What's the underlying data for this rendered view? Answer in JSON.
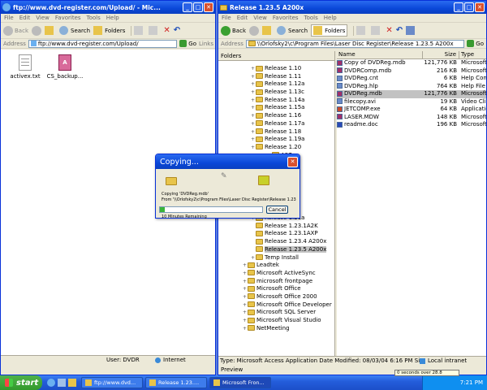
{
  "ie": {
    "title": "ftp://www.dvd-register.com/Upload/ - Mic...",
    "menu": [
      "File",
      "Edit",
      "View",
      "Favorites",
      "Tools",
      "Help"
    ],
    "back_label": "Back",
    "search_label": "Search",
    "folders_label": "Folders",
    "address_label": "Address",
    "address_value": "ftp://www.dvd-register.com/Upload/",
    "go_label": "Go",
    "links_label": "Links",
    "files": [
      "activex.txt",
      "CS_backup..."
    ],
    "status_user": "User: DVDR",
    "status_zone": "Internet"
  },
  "explorer": {
    "title": "Release 1.23.5 A200x",
    "menu": [
      "File",
      "Edit",
      "View",
      "Favorites",
      "Tools",
      "Help"
    ],
    "back_label": "Back",
    "search_label": "Search",
    "folders_label": "Folders",
    "address_label": "Address",
    "address_value": "\\\\Orlofsky2\\c\\Program Files\\Laser Disc Register\\Release 1.23.5 A200x",
    "go_label": "Go",
    "folders_header": "Folders",
    "tree": [
      {
        "label": "Release 1.10",
        "indent": 1,
        "exp": "+"
      },
      {
        "label": "Release 1.11",
        "indent": 1,
        "exp": "+"
      },
      {
        "label": "Release 1.12a",
        "indent": 1,
        "exp": "+"
      },
      {
        "label": "Release 1.13c",
        "indent": 1,
        "exp": "+"
      },
      {
        "label": "Release 1.14a",
        "indent": 1,
        "exp": "+"
      },
      {
        "label": "Release 1.15a",
        "indent": 1,
        "exp": "+"
      },
      {
        "label": "Release 1.16",
        "indent": 1,
        "exp": "+"
      },
      {
        "label": "Release 1.17a",
        "indent": 1,
        "exp": "+"
      },
      {
        "label": "Release 1.18",
        "indent": 1,
        "exp": "+"
      },
      {
        "label": "Release 1.19a",
        "indent": 1,
        "exp": "+"
      },
      {
        "label": "Release 1.20",
        "indent": 1,
        "exp": "+"
      },
      {
        "label": "A97",
        "indent": 3,
        "exp": ""
      },
      {
        "label": "3",
        "indent": 3,
        "exp": ""
      },
      {
        "label": ".5 A97",
        "indent": 3,
        "exp": ""
      },
      {
        "label": ".5A2K",
        "indent": 3,
        "exp": ""
      },
      {
        "label": ".5XP",
        "indent": 3,
        "exp": ""
      },
      {
        "label": ".4XP",
        "indent": 3,
        "exp": ""
      },
      {
        "label": ".7A2K",
        "indent": 3,
        "exp": ""
      },
      {
        "label": ".7AXP",
        "indent": 3,
        "exp": ""
      },
      {
        "label": "Release 1.21a",
        "indent": 1,
        "exp": "+"
      },
      {
        "label": "Release 1.23.1A2K",
        "indent": 1,
        "exp": ""
      },
      {
        "label": "Release 1.23.1AXP",
        "indent": 1,
        "exp": ""
      },
      {
        "label": "Release 1.23.4 A200x",
        "indent": 1,
        "exp": ""
      },
      {
        "label": "Release 1.23.5 A200x",
        "indent": 1,
        "exp": "",
        "sel": true
      },
      {
        "label": "Temp Install",
        "indent": 1,
        "exp": "+"
      },
      {
        "label": "Leadtek",
        "indent": 0,
        "exp": "+"
      },
      {
        "label": "Microsoft ActiveSync",
        "indent": 0,
        "exp": "+"
      },
      {
        "label": "microsoft frontpage",
        "indent": 0,
        "exp": "+"
      },
      {
        "label": "Microsoft Office",
        "indent": 0,
        "exp": "+"
      },
      {
        "label": "Microsoft Office 2000",
        "indent": 0,
        "exp": "+"
      },
      {
        "label": "Microsoft Office Developer",
        "indent": 0,
        "exp": "+"
      },
      {
        "label": "Microsoft SQL Server",
        "indent": 0,
        "exp": "+"
      },
      {
        "label": "Microsoft Visual Studio",
        "indent": 0,
        "exp": "+"
      },
      {
        "label": "NetMeeting",
        "indent": 0,
        "exp": "+"
      }
    ],
    "columns": [
      "Name",
      "Size",
      "Type"
    ],
    "files": [
      {
        "name": "Copy of DVDReg.mdb",
        "size": "121,776 KB",
        "type": "Microsoft Ac",
        "color": "#a0306a"
      },
      {
        "name": "DVDRComp.mdb",
        "size": "216 KB",
        "type": "Microsoft Ac",
        "color": "#a0306a"
      },
      {
        "name": "DVDReg.cnt",
        "size": "6 KB",
        "type": "Help Conter",
        "color": "#6a8ac8"
      },
      {
        "name": "DVDReg.hlp",
        "size": "764 KB",
        "type": "Help File",
        "color": "#6a8ac8"
      },
      {
        "name": "DVDReg.mdb",
        "size": "121,776 KB",
        "type": "Microsoft Ac",
        "color": "#a0306a",
        "sel": true
      },
      {
        "name": "filecopy.avi",
        "size": "19 KB",
        "type": "Video Clip",
        "color": "#6a8ac8"
      },
      {
        "name": "JETCOMP.exe",
        "size": "64 KB",
        "type": "Application",
        "color": "#c84a2a"
      },
      {
        "name": "LASER.MDW",
        "size": "148 KB",
        "type": "Microsoft Ac",
        "color": "#a0306a"
      },
      {
        "name": "readme.doc",
        "size": "196 KB",
        "type": "Microsoft W",
        "color": "#2a4ab8"
      }
    ],
    "status_text": "Type: Microsoft Access Application Date Modified: 08/03/04 6:16 PM Si: 118 MB",
    "status_zone": "Local intranet",
    "preview_text": "Preview"
  },
  "dialog": {
    "title": "Copying...",
    "line1": "Copying 'DVDReg.mdb'",
    "line2": "From '\\\\Orlofsky2\\c\\Program Files\\Laser Disc Register\\Release 1.23.5'",
    "remaining": "10 Minutes Remaining",
    "cancel_label": "Cancel",
    "progress": 0.05
  },
  "taskbar": {
    "start_label": "start",
    "tasks": [
      {
        "label": "ftp://www.dvd...",
        "active": false
      },
      {
        "label": "Release 1.23....",
        "active": false
      },
      {
        "label": "Microsoft Fron...",
        "active": true
      }
    ],
    "tray_notice": "0 seconds over 28.8",
    "clock": "7:21 PM"
  },
  "colors": {
    "desktop": "#5a7edc",
    "title": "#0a47d8",
    "progress": "#3ab43a"
  }
}
